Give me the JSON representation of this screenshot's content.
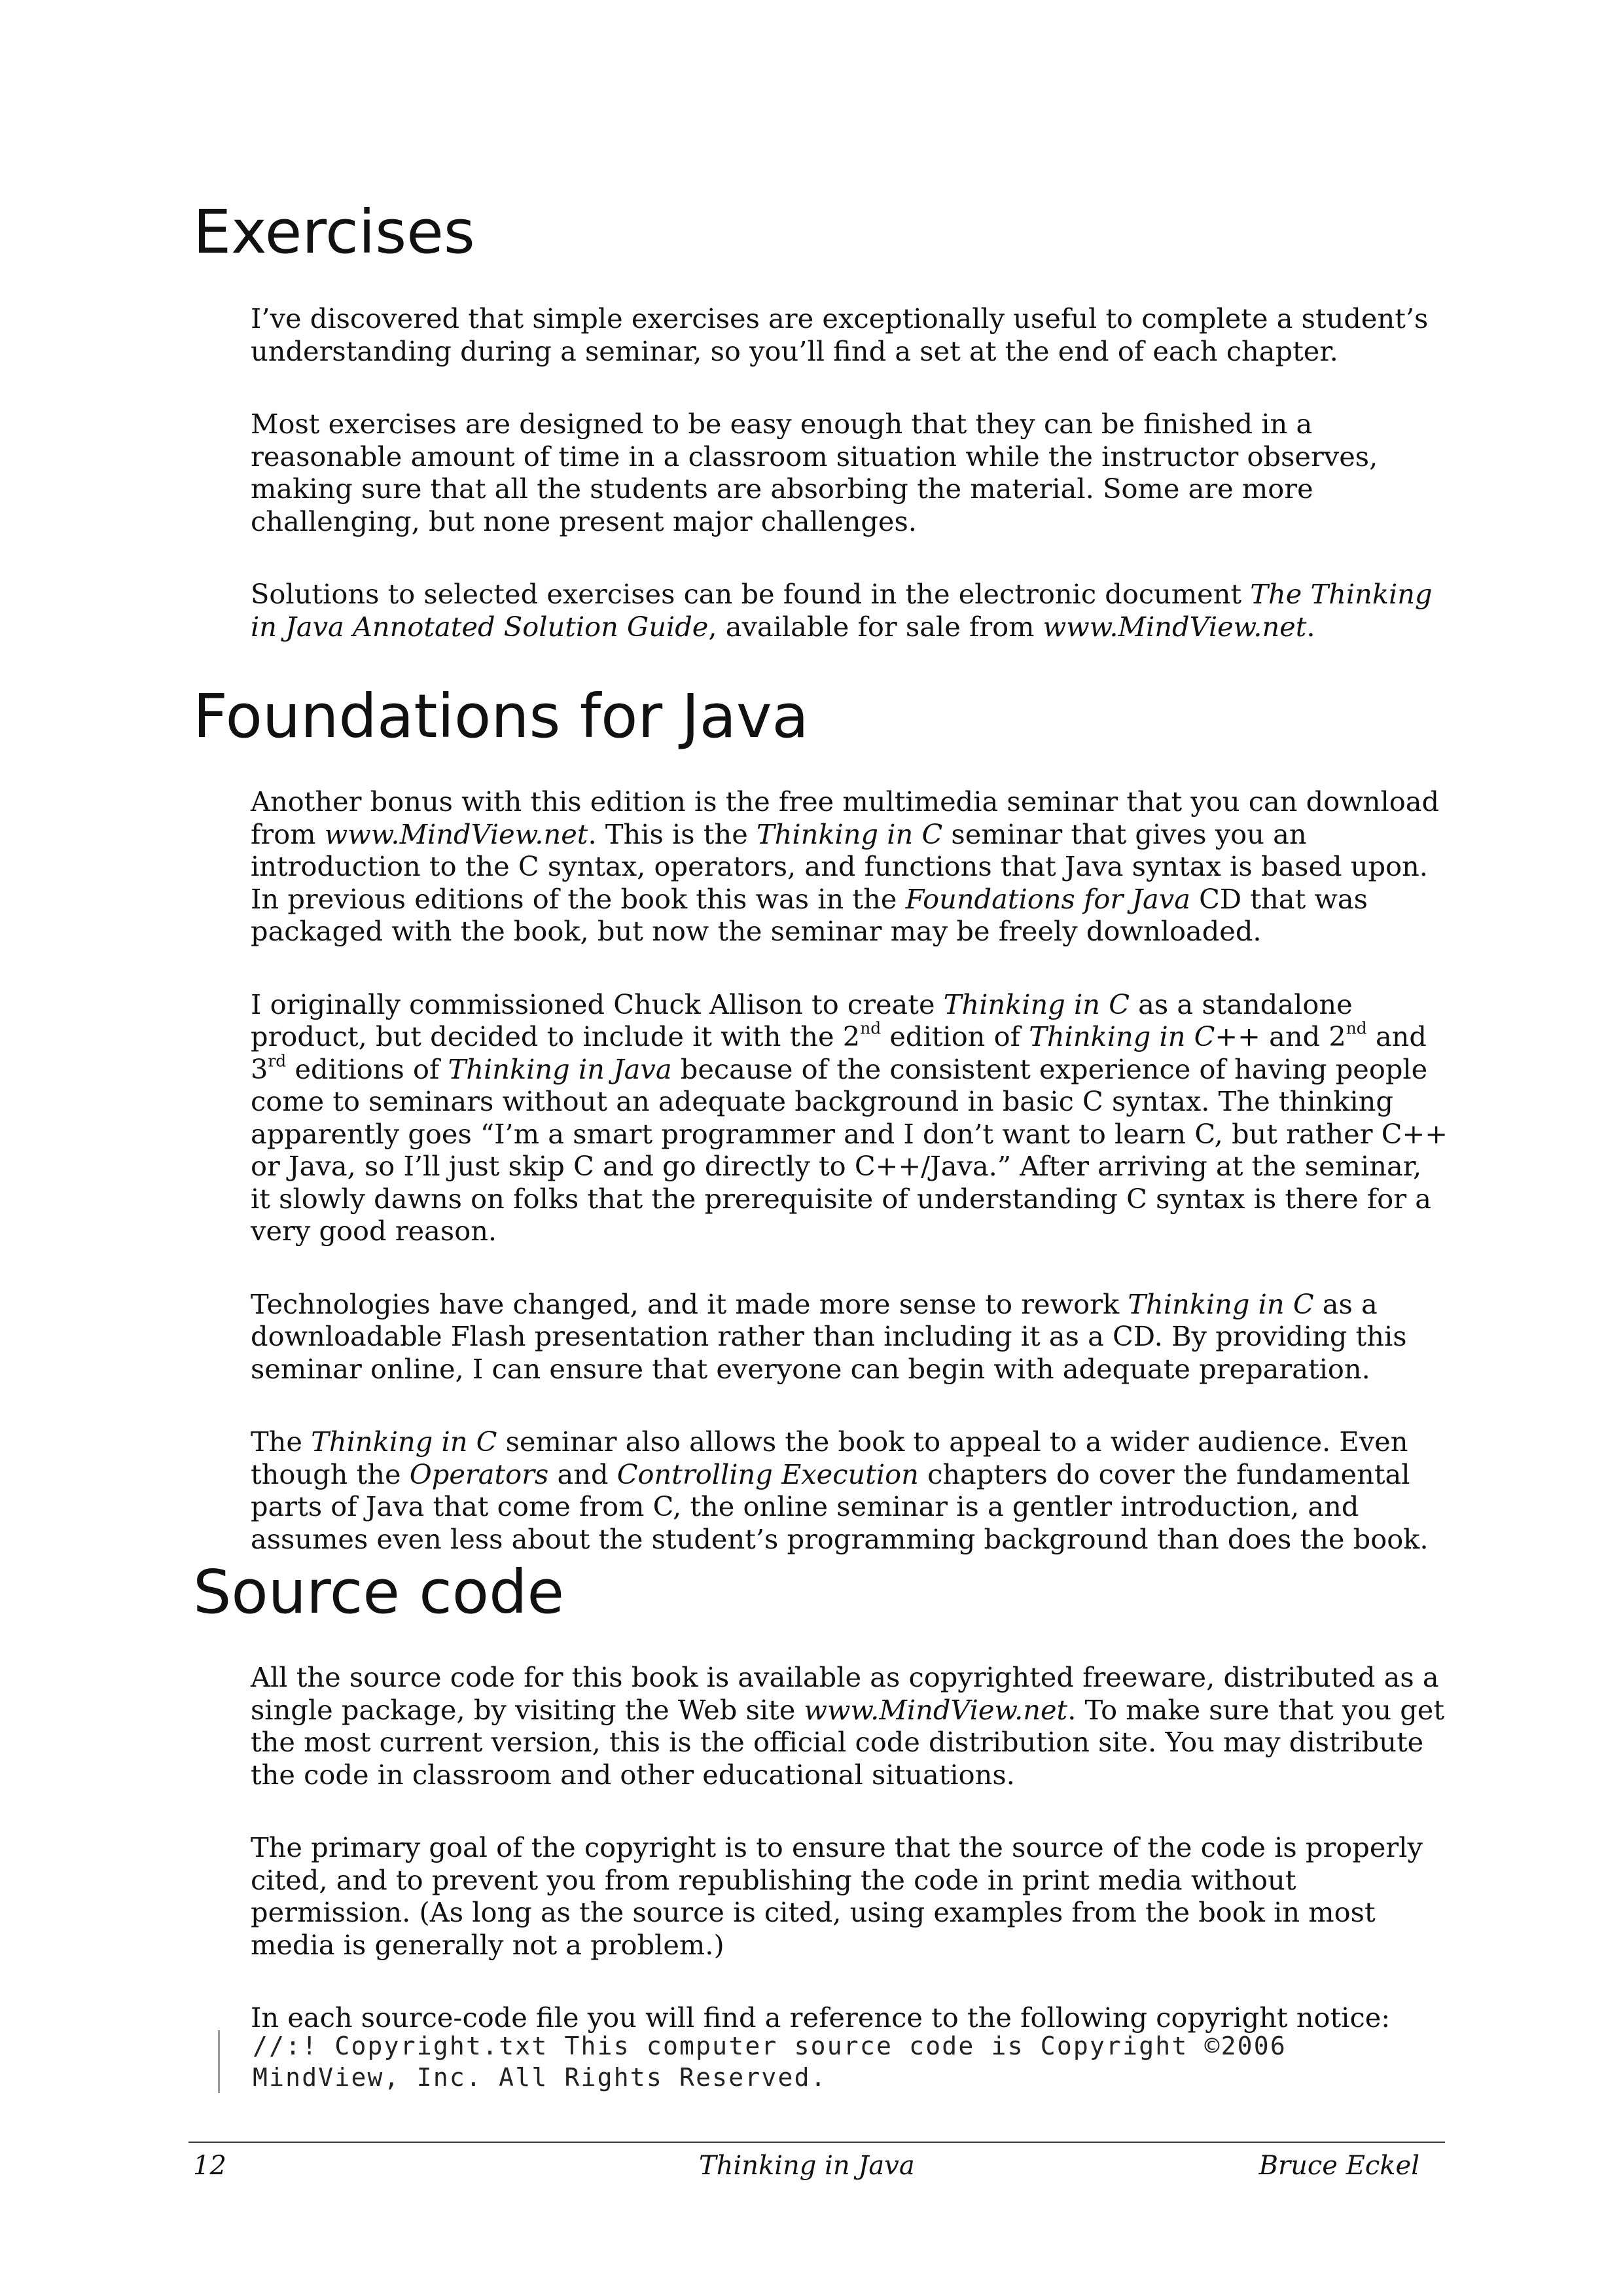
{
  "sections": {
    "exercises": {
      "heading": "Exercises",
      "p1": "I’ve discovered that simple exercises are exceptionally useful to complete a student’s understanding during a seminar, so you’ll find a set at the end of each chapter.",
      "p2": "Most exercises are designed to be easy enough that they can be finished in a reasonable amount of time in a classroom situation while the instructor observes, making sure that all the students are absorbing the material. Some are more challenging, but none present major challenges.",
      "p3": {
        "a": "Solutions to selected exercises can be found in the electronic document ",
        "b": "The Thinking in Java Annotated Solution Guide",
        "c": ", available for sale from ",
        "d": "www.MindView.net",
        "e": "."
      }
    },
    "foundations": {
      "heading": "Foundations for Java",
      "p1": {
        "a": "Another bonus with this edition is the free multimedia seminar that you can download from ",
        "b": "www.MindView.net",
        "c": ". This is the ",
        "d": "Thinking in C",
        "e": " seminar that gives you an introduction to the C syntax, operators, and functions that Java syntax is based upon. In previous editions of the book this was in the ",
        "f": "Foundations for Java",
        "g": " CD that was packaged with the book, but now the seminar may be freely downloaded."
      },
      "p2": {
        "a": "I originally commissioned Chuck Allison to create ",
        "b": "Thinking in C",
        "c": " as a standalone product, but decided to include it with the 2",
        "sup1": "nd",
        "d": " edition of ",
        "e": "Thinking in C++",
        "f": " and 2",
        "sup2": "nd",
        "g": " and 3",
        "sup3": "rd",
        "h": " editions of ",
        "i": "Thinking in Java",
        "j": " because of the consistent experience of having people come to seminars without an adequate background in basic C syntax. The thinking apparently goes “I’m a smart programmer and I don’t want to learn C, but rather C++ or Java, so I’ll just skip C and go directly to C++/Java.” After arriving at the seminar, it slowly dawns on folks that the prerequisite of understanding C syntax is there for a very good reason."
      },
      "p3": {
        "a": "Technologies have changed, and it made more sense to rework ",
        "b": "Thinking in C",
        "c": " as a downloadable Flash presentation rather than including it as a CD. By providing this seminar online, I can ensure that everyone can begin with adequate preparation."
      },
      "p4": {
        "a": "The ",
        "b": "Thinking in C",
        "c": " seminar also allows the book to appeal to a wider audience. Even though the ",
        "d": "Operators",
        "e": " and ",
        "f": "Controlling Execution",
        "g": " chapters do cover the fundamental parts of Java that come from C, the online seminar is a gentler introduction, and assumes even less about the student’s programming background than does the book."
      }
    },
    "source_code": {
      "heading": "Source code",
      "p1": {
        "a": "All the source code for this book is available as copyrighted freeware, distributed as a single package, by visiting the Web site ",
        "b": "www.MindView.net",
        "c": ". To make sure that you get the most current version, this is the official code distribution site. You may distribute the code in classroom and other educational situations."
      },
      "p2": "The primary goal of the copyright is to ensure that the source of the code is properly cited, and to prevent you from republishing the code in print media without permission. (As long as the source is cited, using examples from the book in most media is generally not a problem.)",
      "p3": "In each source-code file you will find a reference to the following copyright notice:",
      "code_line1": "//:! Copyright.txt This computer source code is Copyright ©2006",
      "code_line2": "MindView, Inc. All Rights Reserved."
    }
  },
  "footer": {
    "page_number": "12",
    "book_title": "Thinking in Java",
    "author": "Bruce Eckel"
  }
}
